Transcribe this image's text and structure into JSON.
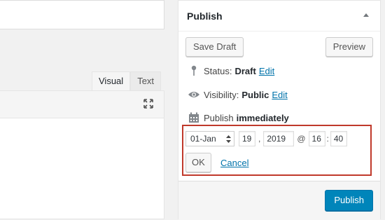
{
  "editor": {
    "tabs": [
      {
        "label": "Visual",
        "active": true
      },
      {
        "label": "Text",
        "active": false
      }
    ],
    "expand_icon": "fullscreen-icon"
  },
  "publish_box": {
    "title": "Publish",
    "save_draft_label": "Save Draft",
    "preview_label": "Preview",
    "status": {
      "label": "Status:",
      "value": "Draft",
      "edit": "Edit",
      "icon": "pin-icon"
    },
    "visibility": {
      "label": "Visibility:",
      "value": "Public",
      "edit": "Edit",
      "icon": "eye-icon"
    },
    "schedule": {
      "label": "Publish",
      "value": "immediately",
      "icon": "calendar-icon"
    },
    "timestamp": {
      "month": "01-Jan",
      "day": "19",
      "comma": ",",
      "year": "2019",
      "at": "@",
      "hour": "16",
      "colon": ":",
      "minute": "40"
    },
    "ok_label": "OK",
    "cancel_label": "Cancel",
    "publish_label": "Publish",
    "colors": {
      "accent": "#0085ba",
      "link": "#0073aa",
      "highlight": "#c0392b"
    }
  }
}
